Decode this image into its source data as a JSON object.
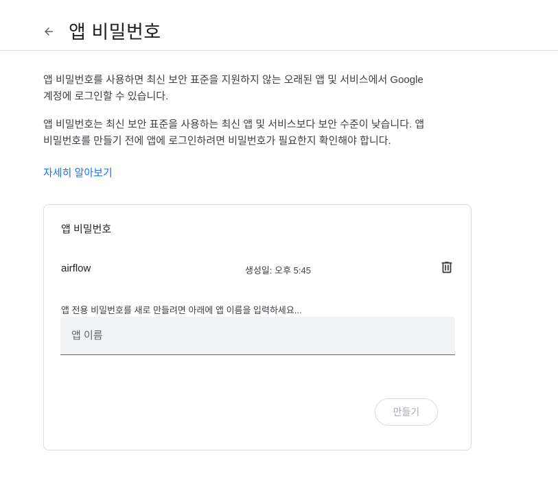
{
  "header": {
    "back_icon": "arrow-left-icon",
    "title": "앱 비밀번호"
  },
  "intro": {
    "paragraph1": "앱 비밀번호를 사용하면 최신 보안 표준을 지원하지 않는 오래된 앱 및 서비스에서 Google 계정에 로그인할 수 있습니다.",
    "paragraph2": "앱 비밀번호는 최신 보안 표준을 사용하는 최신 앱 및 서비스보다 보안 수준이 낮습니다. 앱 비밀번호를 만들기 전에 앱에 로그인하려면 비밀번호가 필요한지 확인해야 합니다.",
    "learn_more": "자세히 알아보기"
  },
  "card": {
    "title": "앱 비밀번호",
    "passwords": [
      {
        "name": "airflow",
        "created": "생성일: 오후 5:45",
        "delete_icon": "trash-icon"
      }
    ],
    "hint": "앱 전용 비밀번호를 새로 만들려면 아래에 앱 이름을 입력하세요...",
    "input_placeholder": "앱 이름",
    "input_value": "",
    "create_label": "만들기"
  },
  "colors": {
    "link": "#1a73e8",
    "border": "#dadce0",
    "input_bg": "#f1f3f4",
    "disabled_text": "#a7abb0"
  }
}
